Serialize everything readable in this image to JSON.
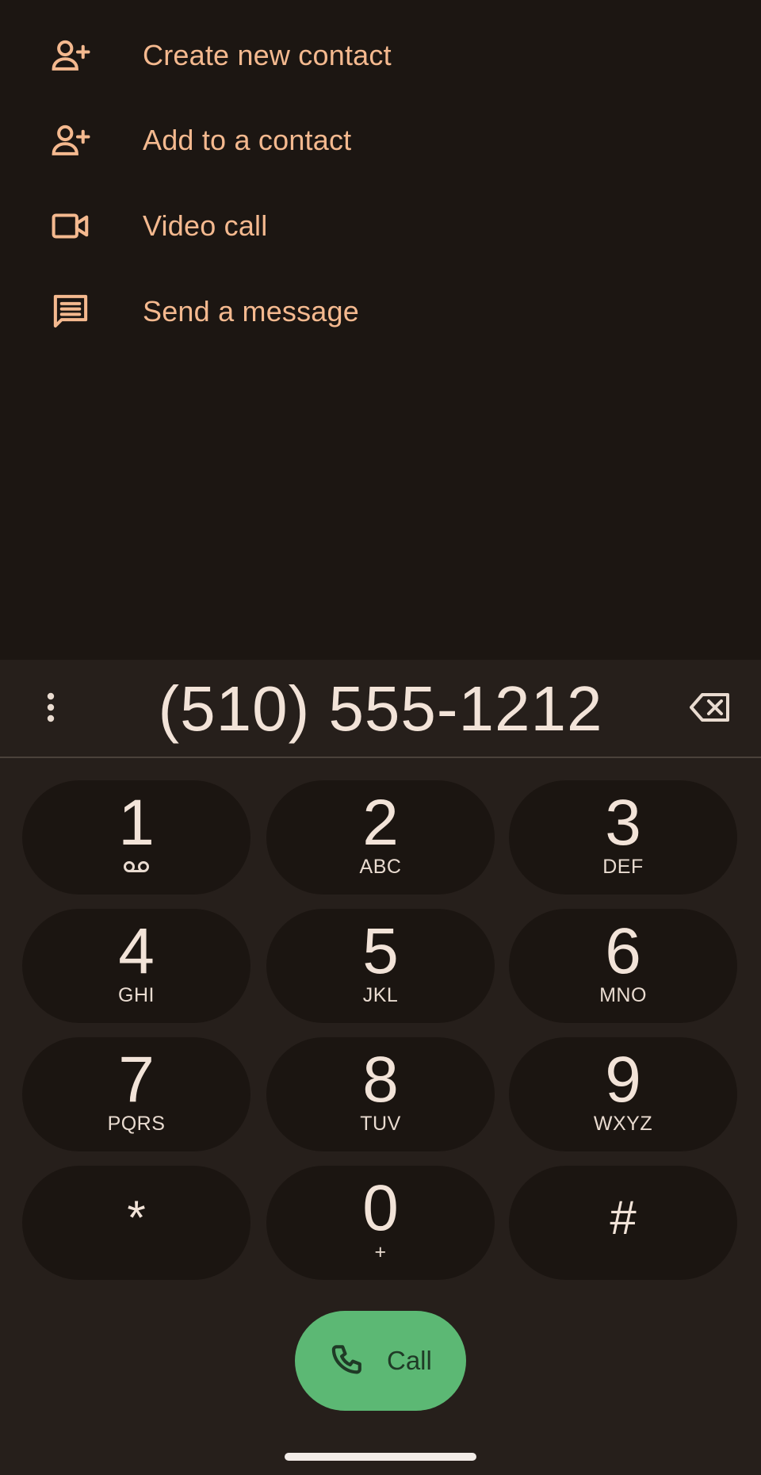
{
  "actions": [
    {
      "label": "Create new contact",
      "icon": "person-add-icon"
    },
    {
      "label": "Add to a contact",
      "icon": "person-add-icon"
    },
    {
      "label": "Video call",
      "icon": "videocam-icon"
    },
    {
      "label": "Send a message",
      "icon": "message-icon"
    }
  ],
  "dialer": {
    "number": "(510) 555-1212"
  },
  "keys": [
    {
      "digit": "1",
      "letters": ""
    },
    {
      "digit": "2",
      "letters": "ABC"
    },
    {
      "digit": "3",
      "letters": "DEF"
    },
    {
      "digit": "4",
      "letters": "GHI"
    },
    {
      "digit": "5",
      "letters": "JKL"
    },
    {
      "digit": "6",
      "letters": "MNO"
    },
    {
      "digit": "7",
      "letters": "PQRS"
    },
    {
      "digit": "8",
      "letters": "TUV"
    },
    {
      "digit": "9",
      "letters": "WXYZ"
    },
    {
      "digit": "*",
      "letters": ""
    },
    {
      "digit": "0",
      "letters": "+"
    },
    {
      "digit": "#",
      "letters": ""
    }
  ],
  "call": {
    "label": "Call"
  },
  "colors": {
    "accent": "#f4b98f",
    "call_green": "#5cb874",
    "background": "#1c1612",
    "dialpad_bg": "#261f1b",
    "key_bg": "#1b1511"
  }
}
